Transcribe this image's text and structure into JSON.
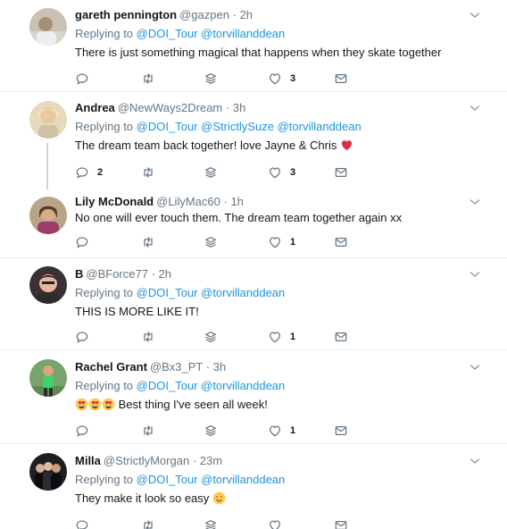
{
  "reply_prefix": "Replying to",
  "tweets": [
    {
      "name": "gareth pennington",
      "handle": "@gazpen",
      "dot": "·",
      "time": "2h",
      "mentions": [
        "@DOI_Tour",
        "@torvillanddean"
      ],
      "text": "There is just something magical that happens when they skate together",
      "replies": "",
      "likes": "3"
    },
    {
      "name": "Andrea",
      "handle": "@NewWays2Dream",
      "dot": "·",
      "time": "3h",
      "mentions": [
        "@DOI_Tour",
        "@StrictlySuze",
        "@torvillanddean"
      ],
      "text": "The dream team back together! love Jayne & Chris",
      "replies": "2",
      "likes": "3"
    },
    {
      "name": "Lily McDonald",
      "handle": "@LilyMac60",
      "dot": "·",
      "time": "1h",
      "text": "No one will ever touch them. The dream team together again xx",
      "replies": "",
      "likes": "1"
    },
    {
      "name": "B",
      "handle": "@BForce77",
      "dot": "·",
      "time": "2h",
      "mentions": [
        "@DOI_Tour",
        "@torvillanddean"
      ],
      "text": "THIS IS MORE LIKE IT!",
      "replies": "",
      "likes": "1"
    },
    {
      "name": "Rachel Grant",
      "handle": "@Bx3_PT",
      "dot": "·",
      "time": "3h",
      "mentions": [
        "@DOI_Tour",
        "@torvillanddean"
      ],
      "text": "Best thing I've seen all week!",
      "replies": "",
      "likes": "1"
    },
    {
      "name": "Milla",
      "handle": "@StrictlyMorgan",
      "dot": "·",
      "time": "23m",
      "mentions": [
        "@DOI_Tour",
        "@torvillanddean"
      ],
      "text": "They make it look so easy",
      "replies": "",
      "likes": ""
    }
  ],
  "icons": {
    "reply": "reply-icon",
    "retweet": "retweet-icon",
    "stack": "stack-icon",
    "like": "heart-icon",
    "dm": "envelope-icon",
    "caret": "chevron-down-icon",
    "heart_emoji": "red-heart-emoji",
    "heart_eyes_emoji": "heart-eyes-emoji",
    "smile_emoji": "smiling-face-emoji"
  },
  "colors": {
    "link": "#1b95e0",
    "secondary": "#657786",
    "text": "#14171a",
    "divider": "#e6ecf0",
    "thread_line": "#ccd6dd",
    "heart_red": "#e0245e"
  }
}
